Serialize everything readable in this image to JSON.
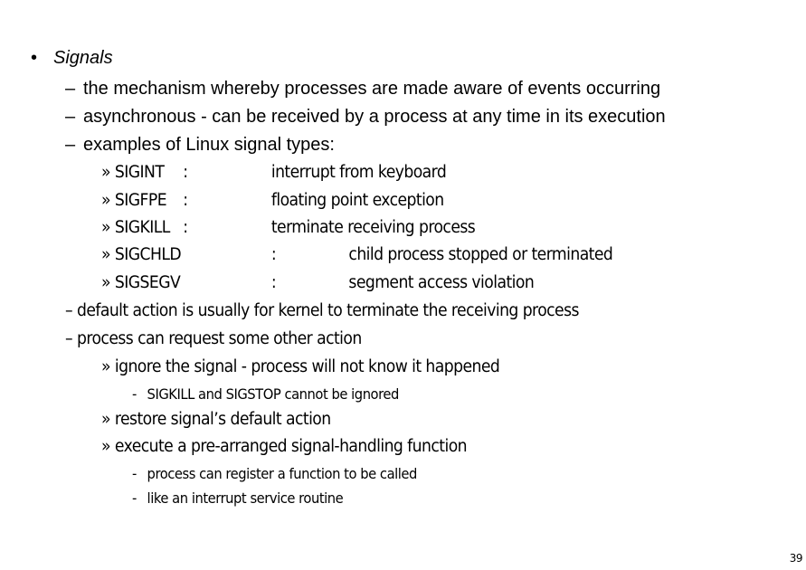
{
  "slide": {
    "heading": {
      "marker": "•",
      "text": "Signals"
    },
    "points": [
      {
        "marker": "–",
        "text": "the mechanism whereby processes are made aware of events occurring"
      },
      {
        "marker": "–",
        "text": "asynchronous - can be received by a process at any time in its execution"
      },
      {
        "marker": "–",
        "text": "examples of Linux signal types:"
      }
    ],
    "signals": [
      {
        "marker": "»",
        "name": "SIGINT",
        "sep": ":",
        "desc": "interrupt from keyboard"
      },
      {
        "marker": "»",
        "name": "SIGFPE",
        "sep": ":",
        "desc": "floating point exception"
      },
      {
        "marker": "»",
        "name": "SIGKILL",
        "sep": ":",
        "desc": "terminate receiving process"
      },
      {
        "marker": "»",
        "name": "SIGCHLD",
        "sep": ":",
        "desc": "child process stopped or terminated"
      },
      {
        "marker": "»",
        "name": "SIGSEGV",
        "sep": ":",
        "desc": "segment access violation"
      }
    ],
    "points2": [
      {
        "marker": "–",
        "text": "default action is usually for kernel to terminate the receiving process"
      },
      {
        "marker": "–",
        "text": "process can request some other action"
      }
    ],
    "actions": [
      {
        "marker": "»",
        "text": "ignore the signal - process will not know it happened",
        "subs": [
          {
            "marker": "-",
            "text": "SIGKILL and SIGSTOP cannot be ignored"
          }
        ]
      },
      {
        "marker": "»",
        "text": "restore signal’s default action",
        "subs": []
      },
      {
        "marker": "»",
        "text": "execute a pre-arranged signal-handling function",
        "subs": [
          {
            "marker": "-",
            "text": "process can register a function to be called"
          },
          {
            "marker": "-",
            "text": "like an interrupt service routine"
          }
        ]
      }
    ],
    "page_number": "39"
  }
}
